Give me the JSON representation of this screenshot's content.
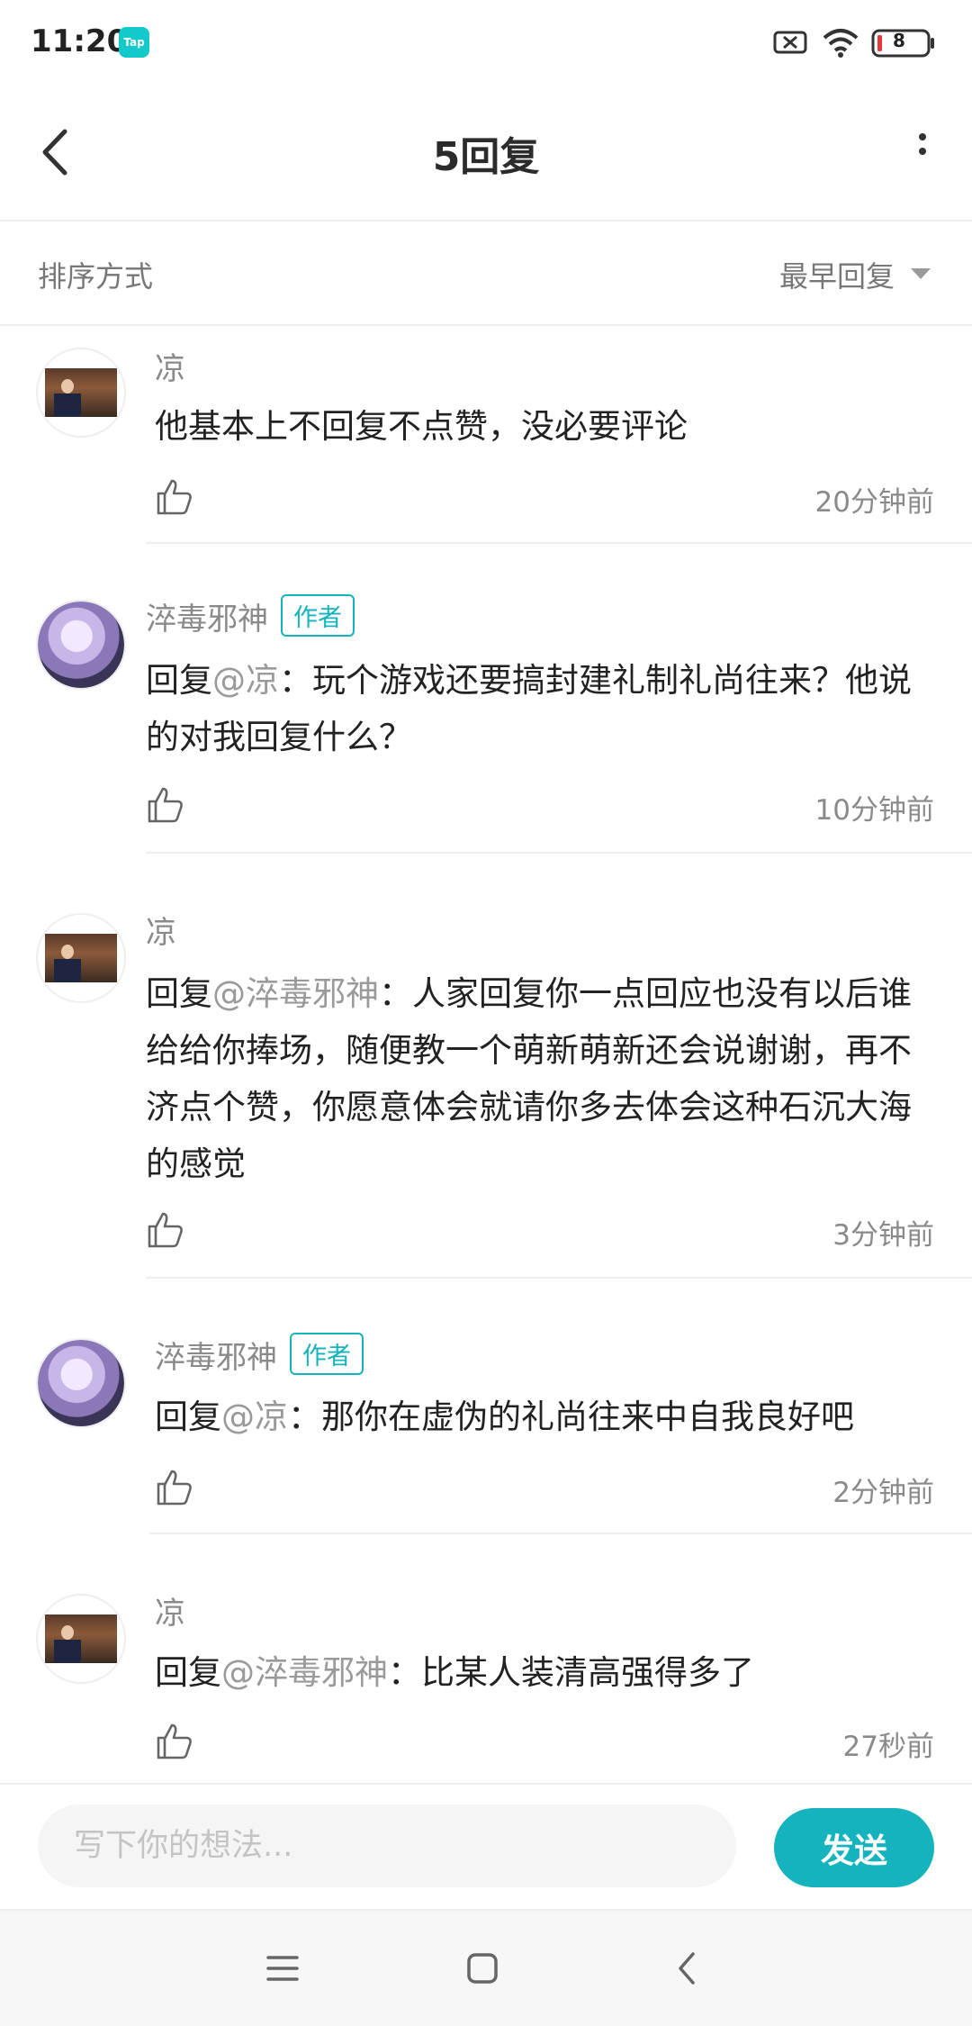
{
  "status_bar": {
    "time": "11:20",
    "app_badge": "Tap",
    "battery": "8"
  },
  "header": {
    "title": "5回复"
  },
  "sort": {
    "label": "排序方式",
    "value": "最早回复"
  },
  "comments": [
    {
      "name": "凉",
      "is_author": false,
      "content": "他基本上不回复不点赞，没必要评论",
      "time": "20分钟前"
    },
    {
      "name": "淬毒邪神",
      "is_author": true,
      "author_tag": "作者",
      "reply_prefix": "回复",
      "mention": "@凉",
      "content": "：玩个游戏还要搞封建礼制礼尚往来？他说的对我回复什么？",
      "time": "10分钟前"
    },
    {
      "name": "凉",
      "is_author": false,
      "reply_prefix": "回复",
      "mention": "@淬毒邪神",
      "content": "：人家回复你一点回应也没有以后谁给给你捧场，随便教一个萌新萌新还会说谢谢，再不济点个赞，你愿意体会就请你多去体会这种石沉大海的感觉",
      "time": "3分钟前"
    },
    {
      "name": "淬毒邪神",
      "is_author": true,
      "author_tag": "作者",
      "reply_prefix": "回复",
      "mention": "@凉",
      "content": "：那你在虚伪的礼尚往来中自我良好吧",
      "time": "2分钟前"
    },
    {
      "name": "凉",
      "is_author": false,
      "reply_prefix": "回复",
      "mention": "@淬毒邪神",
      "content": "：比某人装清高强得多了",
      "time": "27秒前"
    }
  ],
  "composer": {
    "placeholder": "写下你的想法...",
    "send_label": "发送"
  },
  "colors": {
    "accent": "#14b3bd",
    "muted_text": "#8a8a8a",
    "divider": "#eeeeee"
  },
  "icons": [
    "back-icon",
    "more-icon",
    "caret-down-icon",
    "thumbs-up-icon",
    "menu-icon",
    "home-icon",
    "nav-back-icon"
  ]
}
